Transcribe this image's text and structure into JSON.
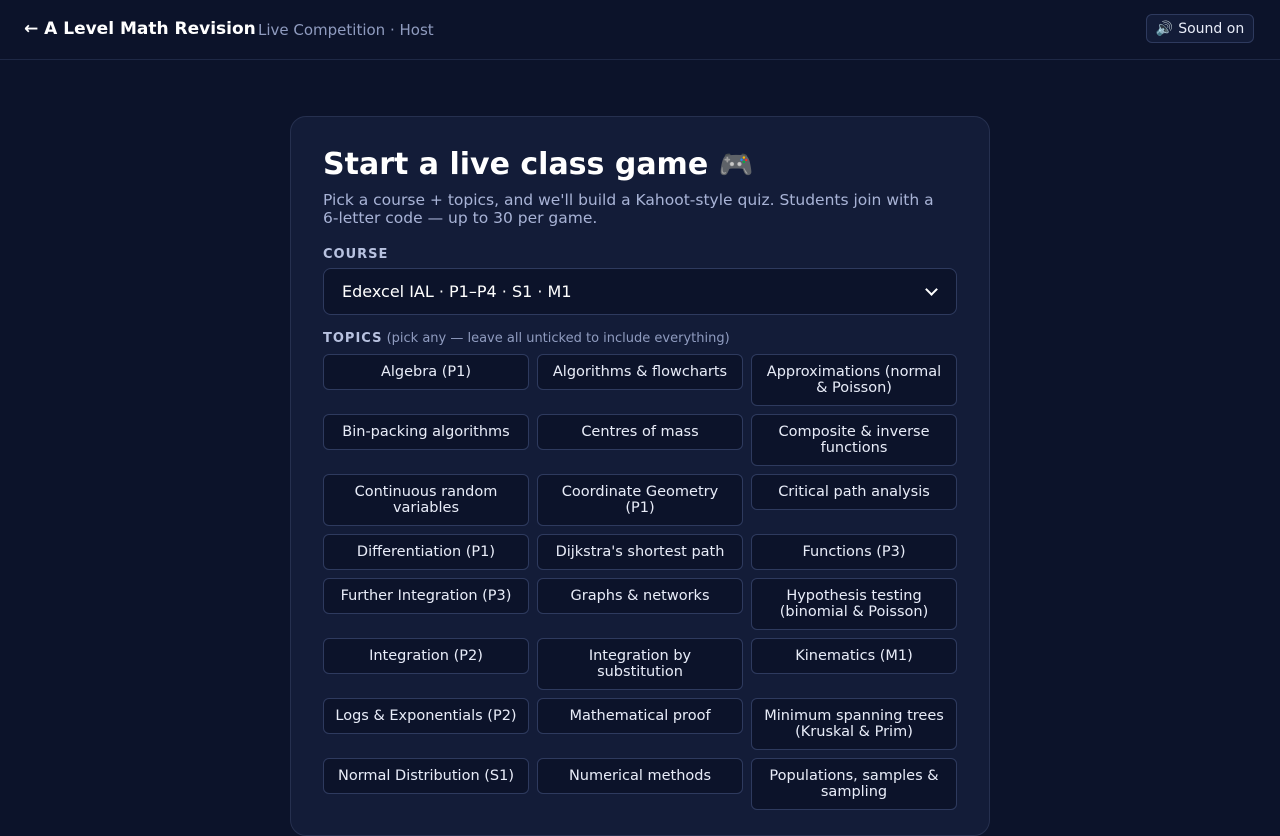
{
  "header": {
    "back_label": "← A Level Math Revision",
    "subtitle": "Live Competition · Host",
    "sound_icon": "🔊",
    "sound_label": "Sound on"
  },
  "card": {
    "title": "Start a live class game",
    "title_icon": "🎮",
    "description": "Pick a course + topics, and we'll build a Kahoot-style quiz. Students join with a 6-letter code — up to 30 per game.",
    "course_label": "COURSE",
    "course_value": "Edexcel IAL · P1–P4 · S1 · M1",
    "topics_label": "TOPICS",
    "topics_hint": "(pick any — leave all unticked to include everything)",
    "topics": [
      "Algebra (P1)",
      "Algorithms & flowcharts",
      "Approximations (normal & Poisson)",
      "Bin-packing algorithms",
      "Centres of mass",
      "Composite & inverse functions",
      "Continuous random variables",
      "Coordinate Geometry (P1)",
      "Critical path analysis",
      "Differentiation (P1)",
      "Dijkstra's shortest path",
      "Functions (P3)",
      "Further Integration (P3)",
      "Graphs & networks",
      "Hypothesis testing (binomial & Poisson)",
      "Integration (P2)",
      "Integration by substitution",
      "Kinematics (M1)",
      "Logs & Exponentials (P2)",
      "Mathematical proof",
      "Minimum spanning trees (Kruskal & Prim)",
      "Normal Distribution (S1)",
      "Numerical methods",
      "Populations, samples & sampling"
    ]
  }
}
